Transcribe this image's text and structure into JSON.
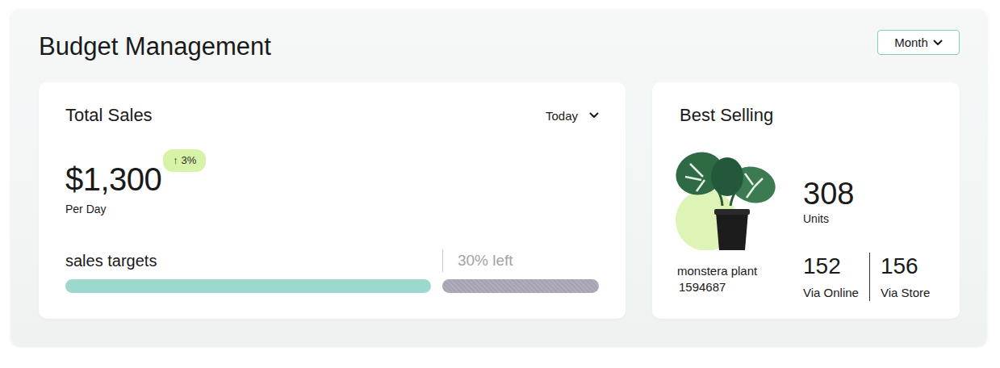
{
  "title": "Budget Management",
  "period_dropdown": {
    "label": "Month"
  },
  "total_sales": {
    "title": "Total Sales",
    "range_dropdown": {
      "label": "Today"
    },
    "amount": "$1,300",
    "change_icon": "↑",
    "change": "3%",
    "unit": "Per Day",
    "target": {
      "label": "sales targets",
      "remaining": "30% left",
      "level": 0.7
    }
  },
  "best_selling": {
    "title": "Best Selling",
    "product": {
      "name": "monstera plant",
      "code": "1594687"
    },
    "units": "308",
    "units_label": "Units",
    "channels": [
      {
        "value": "152",
        "label": "Via Online"
      },
      {
        "value": "156",
        "label": "Via Store"
      }
    ]
  }
}
